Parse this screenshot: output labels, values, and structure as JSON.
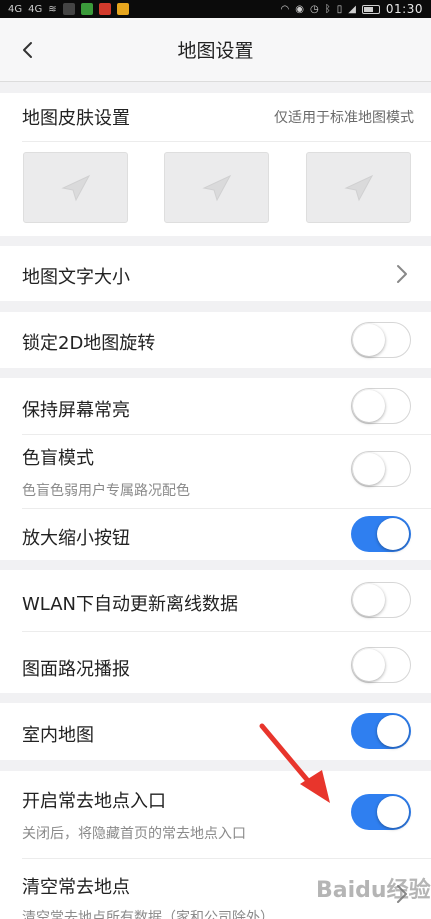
{
  "status_bar": {
    "signal_left": "4G",
    "signal_right": "4G",
    "time": "01:30"
  },
  "header": {
    "title": "地图设置",
    "back_icon": "chevron-left-icon"
  },
  "skin": {
    "label": "地图皮肤设置",
    "hint": "仅适用于标准地图模式",
    "thumbnail_icon": "paper-plane-icon"
  },
  "settings": {
    "text_size": {
      "label": "地图文字大小"
    },
    "lock_rotation": {
      "label": "锁定2D地图旋转",
      "on": false
    },
    "screen_on": {
      "label": "保持屏幕常亮",
      "on": false
    },
    "colorblind": {
      "label": "色盲模式",
      "sub": "色盲色弱用户专属路况配色",
      "on": false
    },
    "zoom_buttons": {
      "label": "放大缩小按钮",
      "on": true
    },
    "wlan_update": {
      "label": "WLAN下自动更新离线数据",
      "on": false
    },
    "traffic_broadcast": {
      "label": "图面路况播报",
      "on": false
    },
    "indoor_map": {
      "label": "室内地图",
      "on": true
    },
    "frequent_places": {
      "label": "开启常去地点入口",
      "sub": "关闭后，将隐藏首页的常去地点入口",
      "on": true
    },
    "clear_places": {
      "label": "清空常去地点",
      "sub": "清空常去地点所有数据（家和公司除外）"
    }
  },
  "colors": {
    "toggle_on": "#2f7ff0",
    "annotation_arrow": "#e8352c"
  },
  "watermark": "Baidu经验"
}
